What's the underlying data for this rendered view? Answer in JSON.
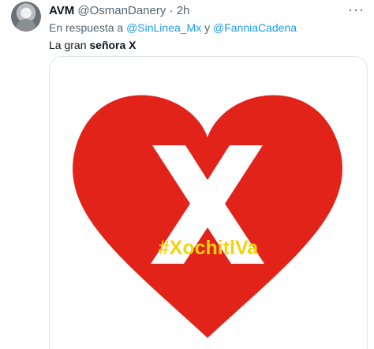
{
  "tweet": {
    "display_name": "AVM",
    "handle": "@OsmanDanery",
    "separator": "·",
    "time": "2h",
    "menu": "···",
    "reply_prefix": "En respuesta a ",
    "reply_user1": "@SinLinea_Mx",
    "reply_conjunction": " y ",
    "reply_user2": "@FanniaCadena",
    "text_prefix": "La gran ",
    "text_bold": "señora X"
  },
  "media": {
    "hashtag": "#XochitlVa",
    "heart_color": "#e2231a",
    "x_color": "#ffffff",
    "hashtag_color": "#f2d40b"
  },
  "colors": {
    "link": "#1d9bf0",
    "secondary_text": "#536471"
  }
}
